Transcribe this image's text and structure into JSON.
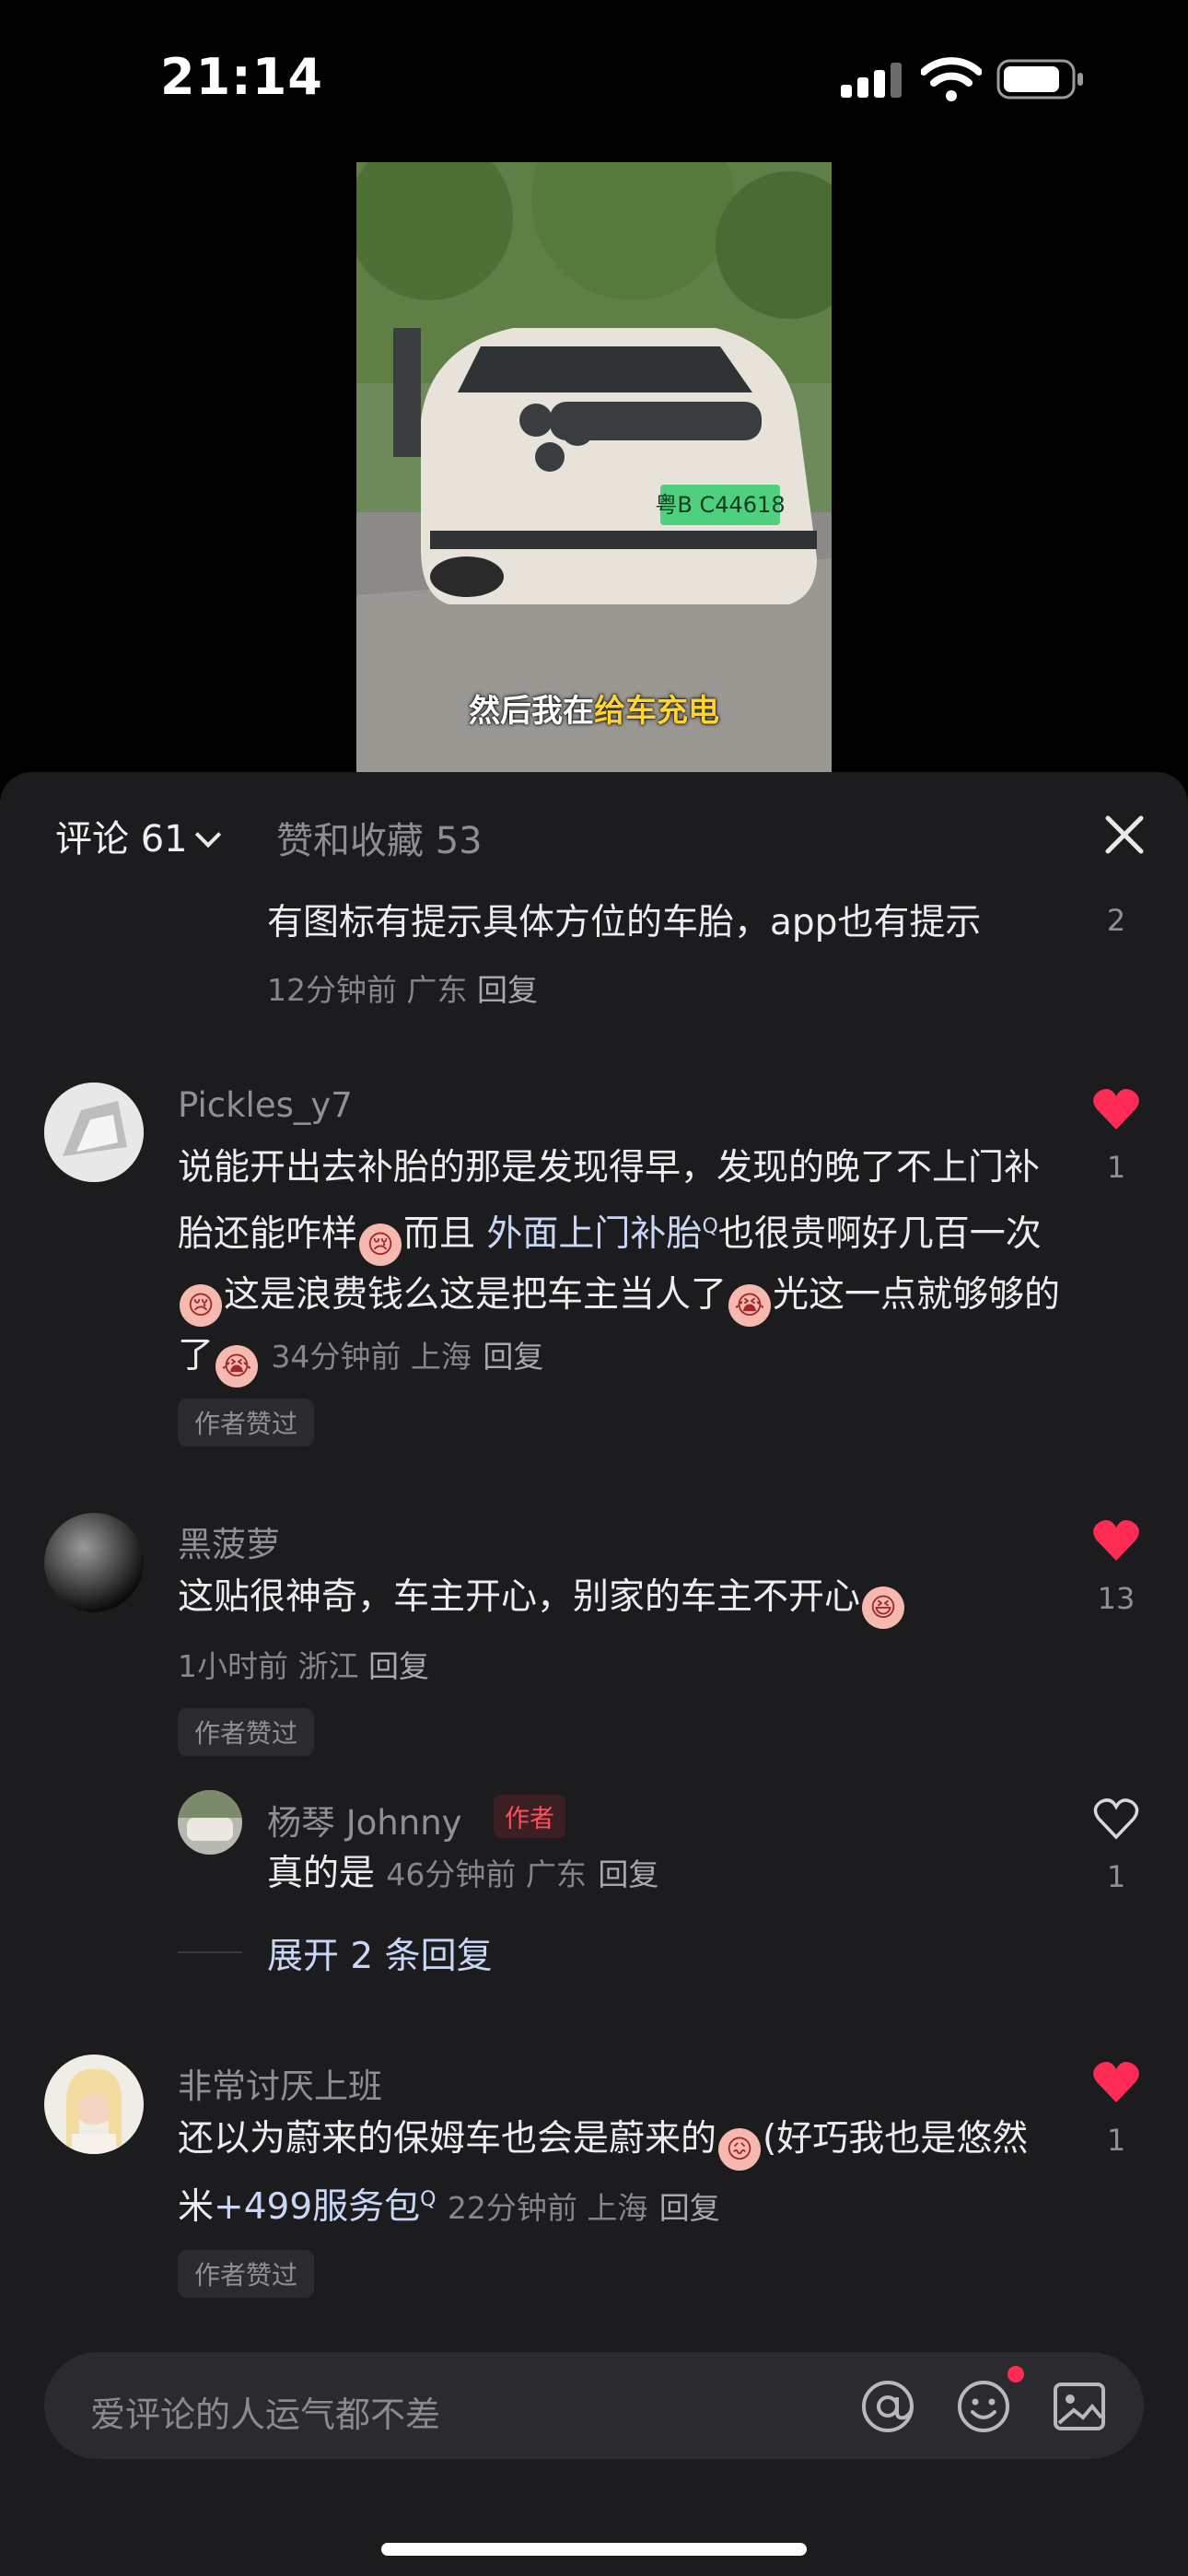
{
  "status": {
    "time": "21:14"
  },
  "video": {
    "subtitle_prefix": "然后我在",
    "subtitle_highlight": "给车充电",
    "plate": "粤B C44618"
  },
  "tabs": {
    "comments": "评论 61",
    "likes": "赞和收藏 53"
  },
  "comments": [
    {
      "text": "有图标有提示具体方位的车胎，app也有提示",
      "meta": "12分钟前 广东",
      "reply": "回复",
      "likes": "2"
    },
    {
      "user": "Pickles_y7",
      "text1": "说能开出去补胎的那是发现得早，发现的晚了不上门补胎还能咋样",
      "text2": "而且 ",
      "text2_link": "外面上门补胎",
      "text3": "也很贵啊好几百一次",
      "text4": "这是浪费钱么这是把车主当人了",
      "text5": "光这一点就够够的了",
      "meta": "34分钟前 上海",
      "reply": "回复",
      "chip": "作者赞过",
      "likes": "1"
    },
    {
      "user": "黑菠萝",
      "text": "这贴很神奇，车主开心，别家的车主不开心",
      "meta": "1小时前 浙江",
      "reply": "回复",
      "chip": "作者赞过",
      "likes": "13",
      "sub_reply": {
        "user": "杨琴 Johnny",
        "tag": "作者",
        "text": "真的是",
        "meta": "46分钟前 广东",
        "reply": "回复",
        "likes": "1"
      },
      "expand": "展开 2 条回复"
    },
    {
      "user": "非常讨厌上班",
      "text1": "还以为蔚来的保姆车也会是蔚来的",
      "text2": "(好巧我也是悠然米",
      "text2_link": "+499服务包",
      "meta": "22分钟前 上海",
      "reply": "回复",
      "chip": "作者赞过",
      "likes": "1"
    }
  ],
  "input": {
    "placeholder": "爱评论的人运气都不差"
  },
  "icons": [
    "signal-icon",
    "wifi-icon",
    "battery-icon",
    "close-icon",
    "heart-icon",
    "at-icon",
    "emoji-icon",
    "image-icon"
  ],
  "colors": {
    "accent_like": "#fe2c55",
    "sheet_bg": "#1c1c1f",
    "link": "#c9d7f7"
  }
}
